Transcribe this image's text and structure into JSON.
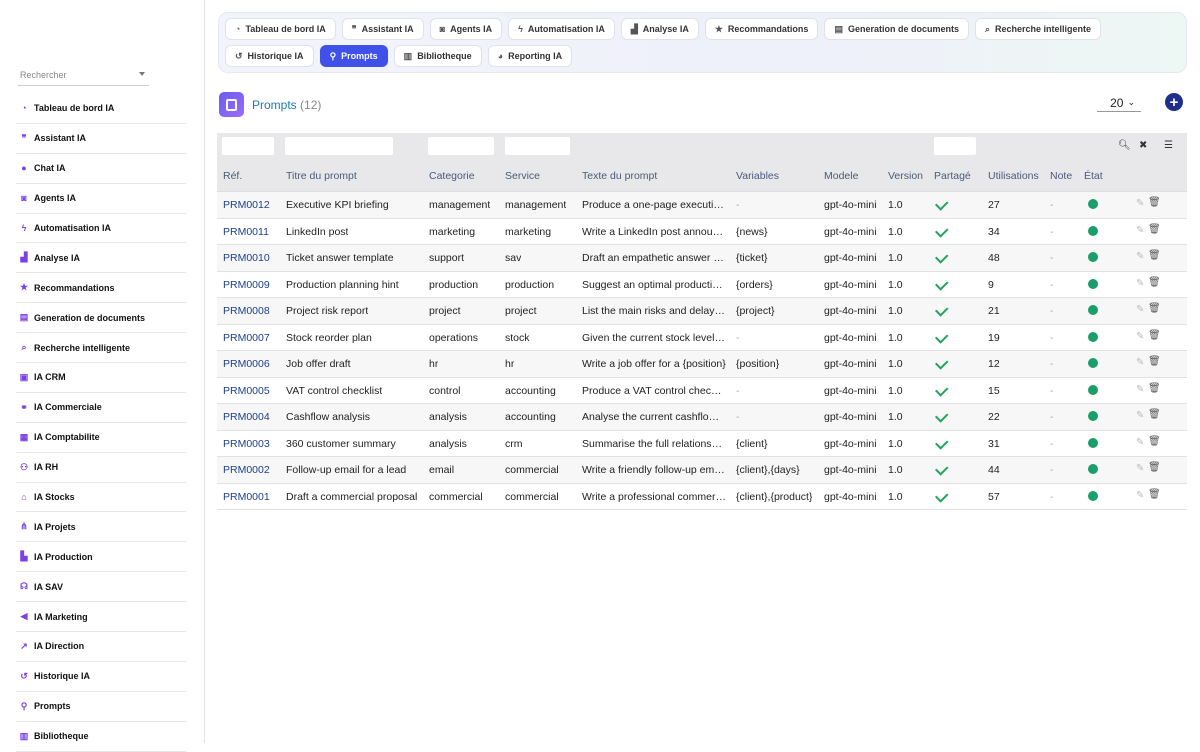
{
  "sidebar": {
    "search_placeholder": "Rechercher",
    "items": [
      {
        "label": "Tableau de bord IA",
        "icon": "dashboard-icon"
      },
      {
        "label": "Assistant IA",
        "icon": "chat-bubbles-icon"
      },
      {
        "label": "Chat IA",
        "icon": "chat-icon"
      },
      {
        "label": "Agents IA",
        "icon": "robot-icon"
      },
      {
        "label": "Automatisation IA",
        "icon": "bolt-icon"
      },
      {
        "label": "Analyse IA",
        "icon": "chart-icon"
      },
      {
        "label": "Recommandations",
        "icon": "star-icon"
      },
      {
        "label": "Generation de documents",
        "icon": "document-icon"
      },
      {
        "label": "Recherche intelligente",
        "icon": "search-icon"
      },
      {
        "label": "IA CRM",
        "icon": "contact-icon"
      },
      {
        "label": "IA Commerciale",
        "icon": "handshake-icon"
      },
      {
        "label": "IA Comptabilite",
        "icon": "calculator-icon"
      },
      {
        "label": "IA RH",
        "icon": "users-icon"
      },
      {
        "label": "IA Stocks",
        "icon": "warehouse-icon"
      },
      {
        "label": "IA Projets",
        "icon": "project-icon"
      },
      {
        "label": "IA Production",
        "icon": "factory-icon"
      },
      {
        "label": "IA SAV",
        "icon": "headset-icon"
      },
      {
        "label": "IA Marketing",
        "icon": "megaphone-icon"
      },
      {
        "label": "IA Direction",
        "icon": "trend-icon"
      },
      {
        "label": "Historique IA",
        "icon": "history-icon"
      },
      {
        "label": "Prompts",
        "icon": "lightbulb-icon"
      },
      {
        "label": "Bibliotheque",
        "icon": "book-icon"
      }
    ]
  },
  "tabs": [
    {
      "label": "Tableau de bord IA",
      "icon": "dashboard-icon",
      "active": false
    },
    {
      "label": "Assistant IA",
      "icon": "chat-bubbles-icon",
      "active": false
    },
    {
      "label": "Agents IA",
      "icon": "robot-icon",
      "active": false
    },
    {
      "label": "Automatisation IA",
      "icon": "bolt-icon",
      "active": false
    },
    {
      "label": "Analyse IA",
      "icon": "chart-icon",
      "active": false
    },
    {
      "label": "Recommandations",
      "icon": "star-icon",
      "active": false
    },
    {
      "label": "Generation de documents",
      "icon": "document-icon",
      "active": false
    },
    {
      "label": "Recherche intelligente",
      "icon": "search-icon",
      "active": false
    },
    {
      "label": "Historique IA",
      "icon": "history-icon",
      "active": false
    },
    {
      "label": "Prompts",
      "icon": "lightbulb-icon",
      "active": true
    },
    {
      "label": "Bibliotheque",
      "icon": "book-icon",
      "active": false
    },
    {
      "label": "Reporting IA",
      "icon": "pie-icon",
      "active": false
    }
  ],
  "page": {
    "title": "Prompts",
    "count": "(12)",
    "per_page": "20",
    "add_icon": "plus-icon",
    "colors": {
      "accent": "#3f51e8",
      "status_active": "#1a9e6a",
      "check": "#20a35a",
      "link": "#1c3f8c"
    }
  },
  "table": {
    "columns": [
      "Réf.",
      "Titre du prompt",
      "Categorie",
      "Service",
      "Texte du prompt",
      "Variables",
      "Modele",
      "Version",
      "Partagé",
      "Utilisations",
      "Note",
      "État"
    ],
    "rows": [
      {
        "ref": "PRM0012",
        "title": "Executive KPI briefing",
        "category": "management",
        "service": "management",
        "text": "Produce a one-page executive KPI briefing",
        "variables": "-",
        "model": "gpt-4o-mini",
        "version": "1.0",
        "uses": "27",
        "note": "-"
      },
      {
        "ref": "PRM0011",
        "title": "LinkedIn post",
        "category": "marketing",
        "service": "marketing",
        "text": "Write a LinkedIn post announcing {news}",
        "variables": "{news}",
        "model": "gpt-4o-mini",
        "version": "1.0",
        "uses": "34",
        "note": "-"
      },
      {
        "ref": "PRM0010",
        "title": "Ticket answer template",
        "category": "support",
        "service": "sav",
        "text": "Draft an empathetic answer to {ticket}",
        "variables": "{ticket}",
        "model": "gpt-4o-mini",
        "version": "1.0",
        "uses": "48",
        "note": "-"
      },
      {
        "ref": "PRM0009",
        "title": "Production planning hint",
        "category": "production",
        "service": "production",
        "text": "Suggest an optimal production plan for {orders}",
        "variables": "{orders}",
        "model": "gpt-4o-mini",
        "version": "1.0",
        "uses": "9",
        "note": "-"
      },
      {
        "ref": "PRM0008",
        "title": "Project risk report",
        "category": "project",
        "service": "project",
        "text": "List the main risks and delays for {project}",
        "variables": "{project}",
        "model": "gpt-4o-mini",
        "version": "1.0",
        "uses": "21",
        "note": "-"
      },
      {
        "ref": "PRM0007",
        "title": "Stock reorder plan",
        "category": "operations",
        "service": "stock",
        "text": "Given the current stock levels, propose a reorder plan",
        "variables": "-",
        "model": "gpt-4o-mini",
        "version": "1.0",
        "uses": "19",
        "note": "-"
      },
      {
        "ref": "PRM0006",
        "title": "Job offer draft",
        "category": "hr",
        "service": "hr",
        "text": "Write a job offer for a {position}",
        "variables": "{position}",
        "model": "gpt-4o-mini",
        "version": "1.0",
        "uses": "12",
        "note": "-"
      },
      {
        "ref": "PRM0005",
        "title": "VAT control checklist",
        "category": "control",
        "service": "accounting",
        "text": "Produce a VAT control checklist",
        "variables": "-",
        "model": "gpt-4o-mini",
        "version": "1.0",
        "uses": "15",
        "note": "-"
      },
      {
        "ref": "PRM0004",
        "title": "Cashflow analysis",
        "category": "analysis",
        "service": "accounting",
        "text": "Analyse the current cashflow situation",
        "variables": "-",
        "model": "gpt-4o-mini",
        "version": "1.0",
        "uses": "22",
        "note": "-"
      },
      {
        "ref": "PRM0003",
        "title": "360 customer summary",
        "category": "analysis",
        "service": "crm",
        "text": "Summarise the full relationship with {client}",
        "variables": "{client}",
        "model": "gpt-4o-mini",
        "version": "1.0",
        "uses": "31",
        "note": "-"
      },
      {
        "ref": "PRM0002",
        "title": "Follow-up email for a lead",
        "category": "email",
        "service": "commercial",
        "text": "Write a friendly follow-up email to {client} after {days}",
        "variables": "{client},{days}",
        "model": "gpt-4o-mini",
        "version": "1.0",
        "uses": "44",
        "note": "-"
      },
      {
        "ref": "PRM0001",
        "title": "Draft a commercial proposal",
        "category": "commercial",
        "service": "commercial",
        "text": "Write a professional commercial proposal for {client} about {product}",
        "variables": "{client},{product}",
        "model": "gpt-4o-mini",
        "version": "1.0",
        "uses": "57",
        "note": "-"
      }
    ]
  }
}
